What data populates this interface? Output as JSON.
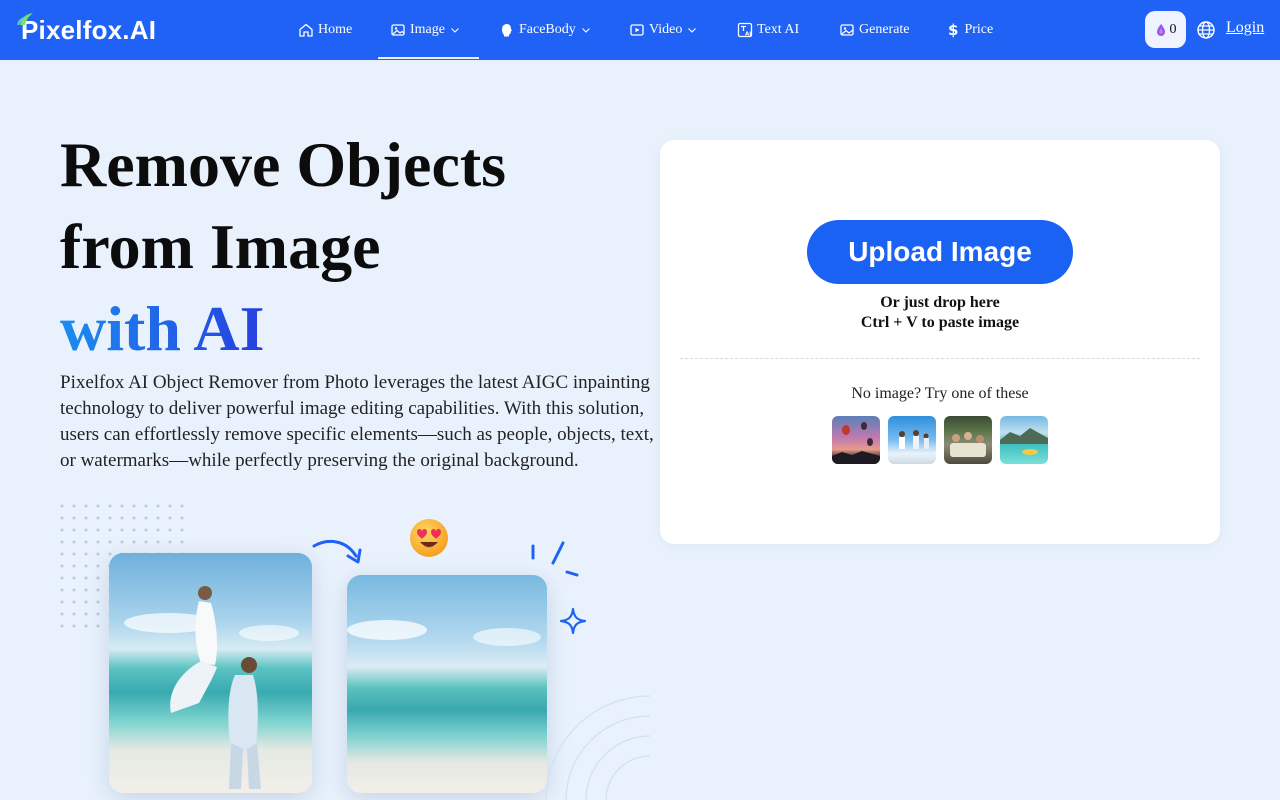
{
  "header": {
    "logo_text": "Pixelfox.AI",
    "nav": [
      {
        "label": "Home",
        "icon": "home-icon",
        "has_dropdown": false
      },
      {
        "label": "Image",
        "icon": "image-icon",
        "has_dropdown": true,
        "active": true
      },
      {
        "label": "FaceBody",
        "icon": "face-icon",
        "has_dropdown": true
      },
      {
        "label": "Video",
        "icon": "video-icon",
        "has_dropdown": true
      },
      {
        "label": "Text AI",
        "icon": "text-ai-icon",
        "has_dropdown": false
      },
      {
        "label": "Generate",
        "icon": "generate-icon",
        "has_dropdown": false
      },
      {
        "label": "Price",
        "icon": "dollar-icon",
        "has_dropdown": false
      }
    ],
    "credits": "0",
    "login_label": "Login"
  },
  "hero": {
    "title_line1": "Remove Objects",
    "title_line2": "from Image",
    "title_accent": "with AI",
    "description": "Pixelfox AI Object Remover from Photo leverages the latest AIGC inpainting technology to deliver powerful image editing capabilities. With this solution, users can effortlessly remove specific elements—such as people, objects, text, or watermarks—while perfectly preserving the original background."
  },
  "upload": {
    "button_label": "Upload Image",
    "drop_hint": "Or just drop here",
    "paste_hint": "Ctrl + V to paste image",
    "try_label": "No image? Try one of these"
  },
  "colors": {
    "brand": "#1f62f5",
    "page_bg": "#e9f2fc",
    "button": "#1a62f4"
  }
}
